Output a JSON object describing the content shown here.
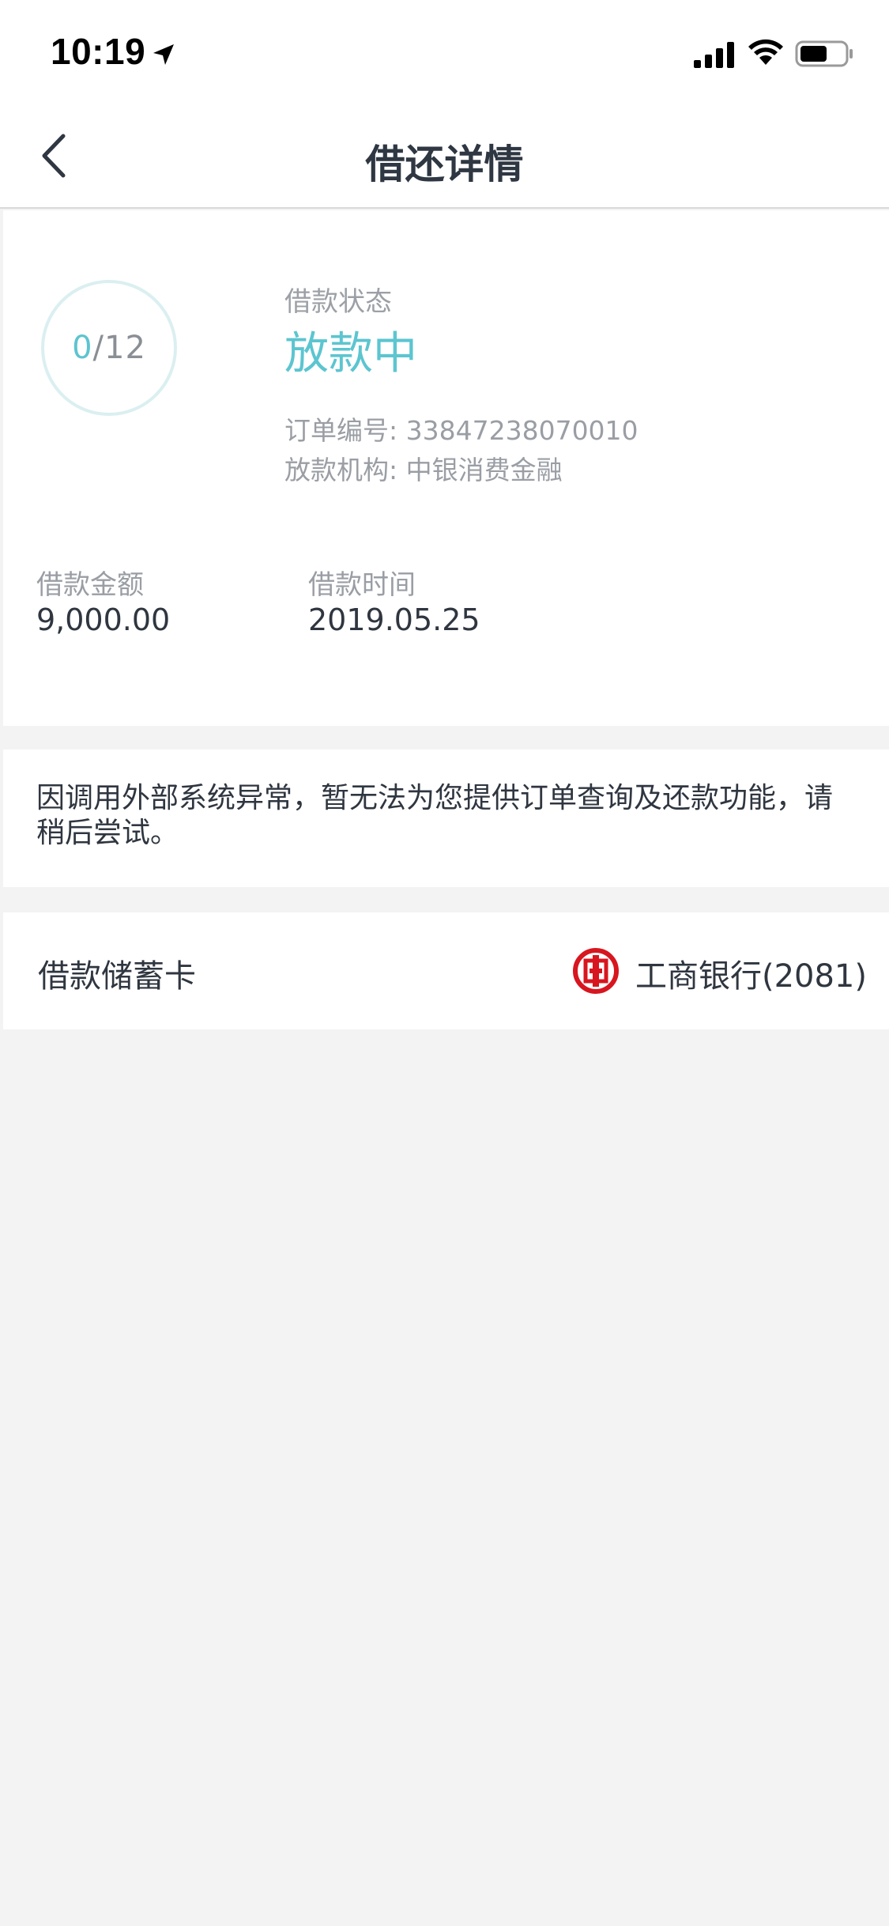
{
  "status_bar": {
    "time": "10:19"
  },
  "nav": {
    "title": "借还详情"
  },
  "summary": {
    "progress_current": "0",
    "progress_total": "/12",
    "status_label": "借款状态",
    "status_value": "放款中",
    "order_label_and_value": "订单编号: 33847238070010",
    "institution_label_and_value": "放款机构: 中银消费金融",
    "amount_label": "借款金额",
    "amount_value": "9,000.00",
    "time_label": "借款时间",
    "time_value": "2019.05.25"
  },
  "notice": {
    "text": "因调用外部系统异常，暂无法为您提供订单查询及还款功能，请稍后尝试。"
  },
  "debit_card": {
    "label": "借款储蓄卡",
    "bank": "工商银行(2081)"
  },
  "colors": {
    "accent": "#5cc5d0",
    "ring": "#dbeff1",
    "bank_red": "#d7161f",
    "background": "#f3f3f3"
  },
  "icons": {
    "back": "back-chevron-icon",
    "location": "location-arrow-icon",
    "signal": "cellular-signal-icon",
    "wifi": "wifi-icon",
    "battery": "battery-icon",
    "bank": "icbc-logo-icon"
  }
}
